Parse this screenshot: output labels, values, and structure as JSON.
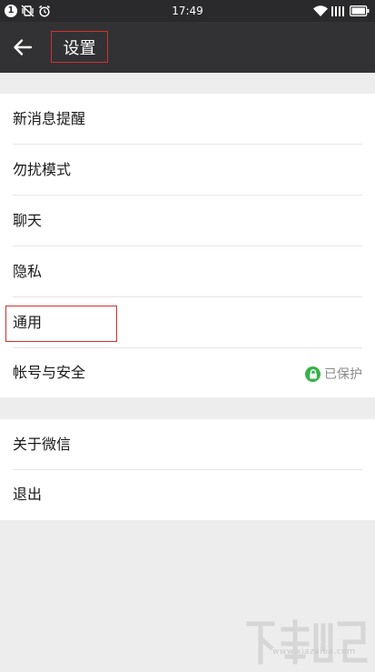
{
  "status_bar": {
    "time": "17:49",
    "notification_count": "1"
  },
  "header": {
    "title": "设置"
  },
  "settings": {
    "group1": [
      {
        "label": "新消息提醒"
      },
      {
        "label": "勿扰模式"
      },
      {
        "label": "聊天"
      },
      {
        "label": "隐私"
      },
      {
        "label": "通用"
      },
      {
        "label": "帐号与安全",
        "status": "已保护"
      }
    ],
    "group2": [
      {
        "label": "关于微信"
      },
      {
        "label": "退出"
      }
    ]
  },
  "watermark": {
    "url": "www.xiazaiba.com"
  },
  "colors": {
    "status_bar_bg": "#2a2a2c",
    "title_bar_bg": "#323235",
    "page_bg": "#ededed",
    "highlight": "#d0312d",
    "protected_green": "#36b24a"
  }
}
